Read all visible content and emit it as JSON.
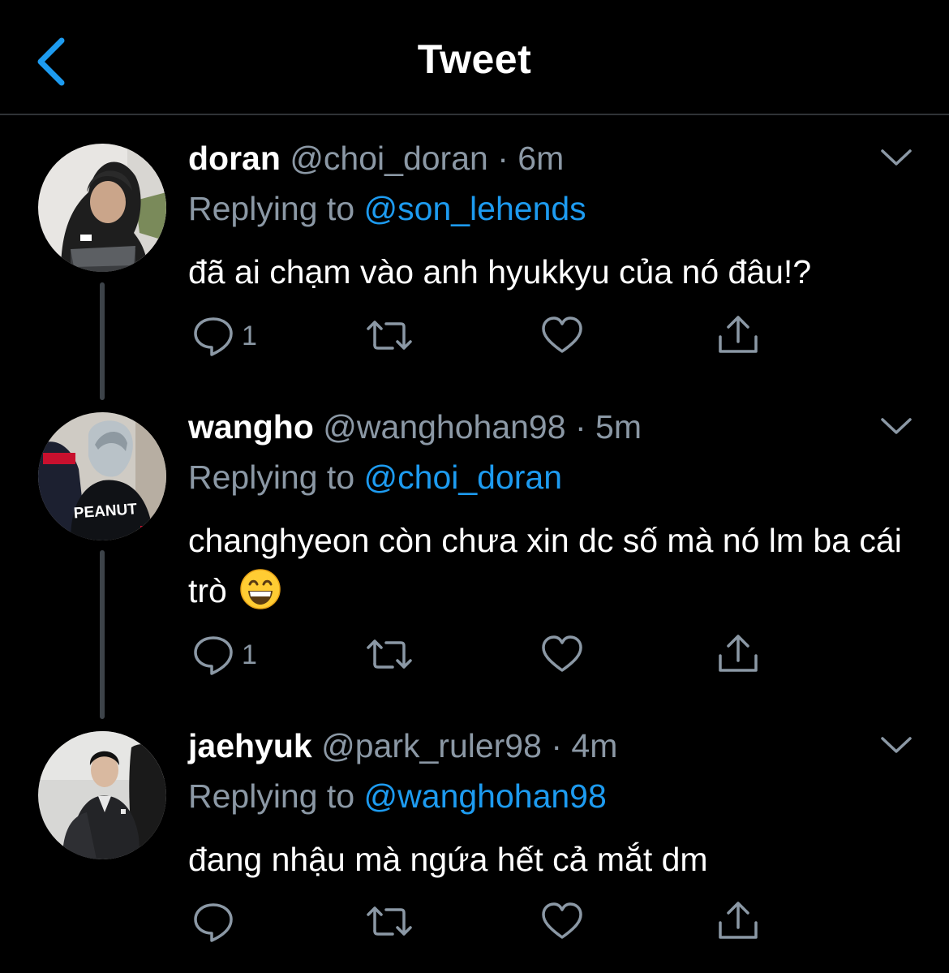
{
  "header": {
    "title": "Tweet",
    "back_icon": "chevron-left-icon",
    "accent_color": "#1d9bf0"
  },
  "tweets": [
    {
      "name": "doran",
      "handle": "@choi_doran",
      "separator": "·",
      "time": "6m",
      "replying_label": "Replying to",
      "replying_to": "@son_lehends",
      "text": "đã ai chạm vào anh hyukkyu của nó đâu!?",
      "emoji": "",
      "reply_count": "1",
      "retweet_count": "",
      "like_count": ""
    },
    {
      "name": "wangho",
      "handle": "@wanghohan98",
      "separator": "·",
      "time": "5m",
      "replying_label": "Replying to",
      "replying_to": "@choi_doran",
      "text": "changhyeon còn chưa xin dc số mà nó lm ba cái trò",
      "emoji": "grinning-face",
      "reply_count": "1",
      "retweet_count": "",
      "like_count": ""
    },
    {
      "name": "jaehyuk",
      "handle": "@park_ruler98",
      "separator": "·",
      "time": "4m",
      "replying_label": "Replying to",
      "replying_to": "@wanghohan98",
      "text": "đang nhậu mà ngứa hết cả mắt dm",
      "emoji": "",
      "reply_count": "",
      "retweet_count": "",
      "like_count": ""
    }
  ],
  "colors": {
    "background": "#000000",
    "text": "#ffffff",
    "secondary_text": "#8b98a5",
    "mention": "#1d9bf0",
    "divider": "#2f3336"
  }
}
